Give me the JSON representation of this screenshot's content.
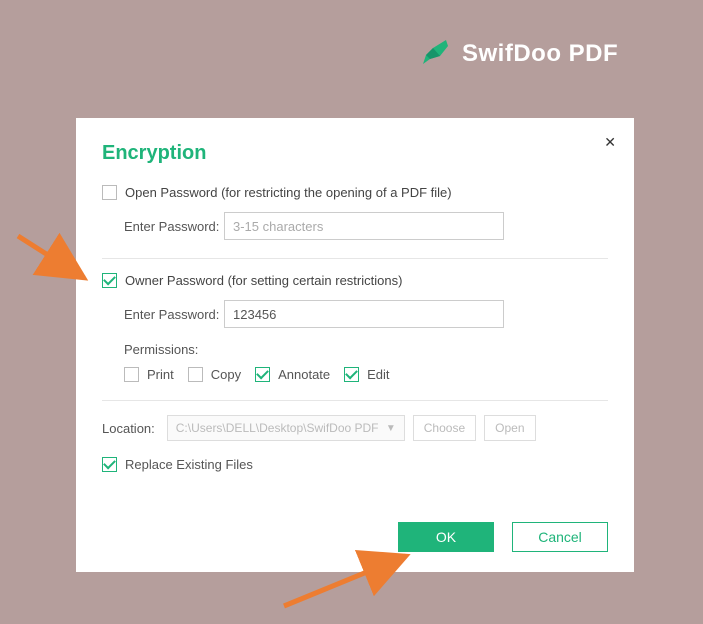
{
  "brand": {
    "name": "SwifDoo PDF"
  },
  "dialog": {
    "title": "Encryption",
    "open_password": {
      "label": "Open Password (for restricting the opening of a PDF file)",
      "checked": false,
      "field_label": "Enter Password:",
      "placeholder": "3-15 characters",
      "value": ""
    },
    "owner_password": {
      "label": "Owner Password (for setting certain restrictions)",
      "checked": true,
      "field_label": "Enter Password:",
      "value": "123456",
      "permissions_label": "Permissions:",
      "permissions": {
        "print": {
          "label": "Print",
          "checked": false
        },
        "copy": {
          "label": "Copy",
          "checked": false
        },
        "annotate": {
          "label": "Annotate",
          "checked": true
        },
        "edit": {
          "label": "Edit",
          "checked": true
        }
      }
    },
    "location": {
      "label": "Location:",
      "path": "C:\\Users\\DELL\\Desktop\\SwifDoo PDF",
      "choose_label": "Choose",
      "open_label": "Open"
    },
    "replace": {
      "label": "Replace Existing Files",
      "checked": true
    },
    "buttons": {
      "ok": "OK",
      "cancel": "Cancel"
    }
  }
}
